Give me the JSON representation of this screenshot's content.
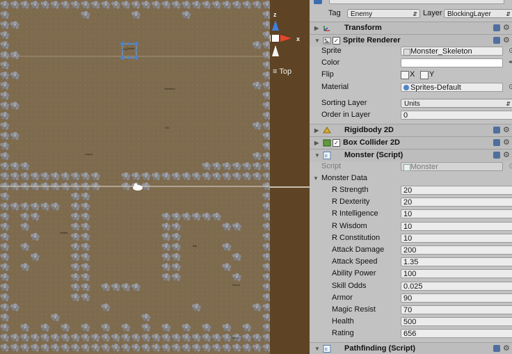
{
  "header": {
    "tag_label": "Tag",
    "tag_value": "Enemy",
    "layer_label": "Layer",
    "layer_value": "BlockingLayer"
  },
  "components": {
    "transform": "Transform",
    "sprite_renderer": "Sprite Renderer",
    "rigidbody": "Rigidbody 2D",
    "box_collider": "Box Collider 2D",
    "monster_script": "Monster (Script)",
    "pathfinding": "Pathfinding (Script)"
  },
  "sprite_renderer": {
    "sprite_label": "Sprite",
    "sprite_value": "Monster_Skeleton",
    "color_label": "Color",
    "flip_label": "Flip",
    "flip_x": "X",
    "flip_y": "Y",
    "material_label": "Material",
    "material_value": "Sprites-Default",
    "sorting_layer_label": "Sorting Layer",
    "sorting_layer_value": "Units",
    "order_label": "Order in Layer",
    "order_value": "0"
  },
  "monster_script": {
    "script_label": "Script",
    "script_value": "Monster",
    "data_label": "Monster Data",
    "fields": [
      {
        "label": "R Strength",
        "value": "20"
      },
      {
        "label": "R Dexterity",
        "value": "20"
      },
      {
        "label": "R Intelligence",
        "value": "10"
      },
      {
        "label": "R Wisdom",
        "value": "10"
      },
      {
        "label": "R Constitution",
        "value": "10"
      },
      {
        "label": "Attack Damage",
        "value": "200"
      },
      {
        "label": "Attack Speed",
        "value": "1.35"
      },
      {
        "label": "Ability Power",
        "value": "100"
      },
      {
        "label": "Skill Odds",
        "value": "0.025"
      },
      {
        "label": "Armor",
        "value": "90"
      },
      {
        "label": "Magic Resist",
        "value": "70"
      },
      {
        "label": "Health",
        "value": "500"
      },
      {
        "label": "Rating",
        "value": "656"
      }
    ]
  },
  "scene": {
    "view_label": "Top",
    "axis_z": "z",
    "axis_x": "x",
    "monster_labels": [
      "Goblin",
      "Skeleton",
      "Orc",
      "Lizard",
      "Wraith",
      "Bat",
      "Ghoul",
      "Slime",
      "Imp"
    ]
  },
  "colors": {
    "ground": "#7e6a4d",
    "rock": "#8e9096",
    "gizmo_strip": "#5e4324",
    "axis_z": "#3f7fe0",
    "axis_x": "#e8462b",
    "inspector_bg": "#c2c2c2"
  },
  "icons": [
    "transform-icon",
    "sprite-renderer-icon",
    "rigidbody-icon",
    "box-collider-icon",
    "script-icon",
    "gear-icon",
    "help-book-icon"
  ]
}
